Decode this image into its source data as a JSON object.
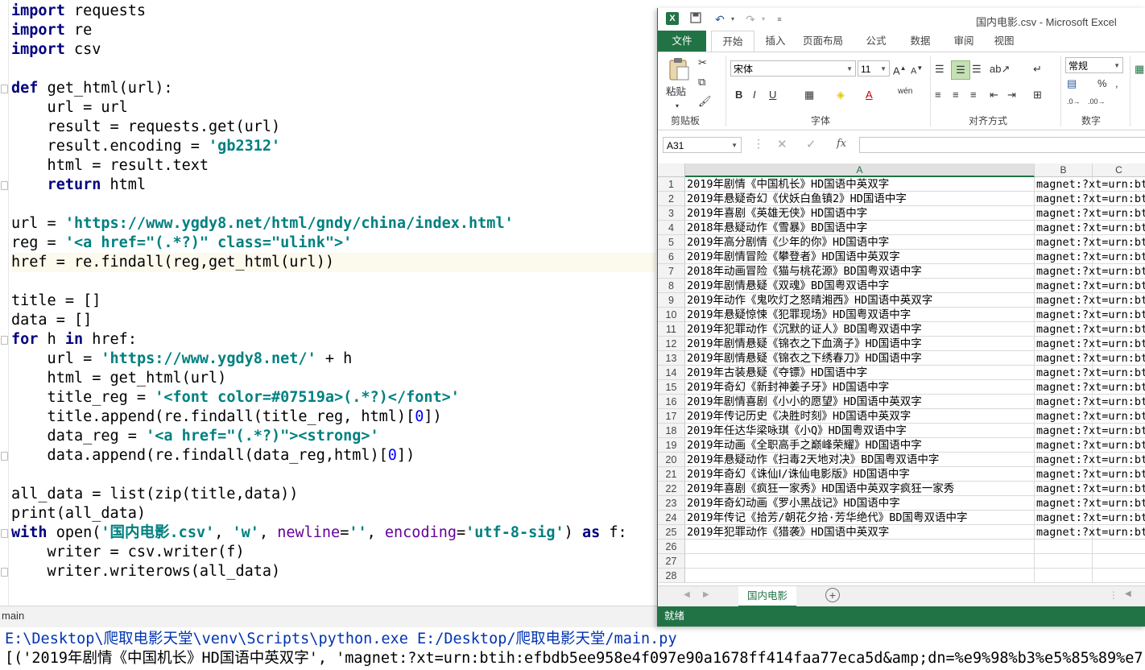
{
  "editor": {
    "lines": [
      [
        [
          "kw",
          "import"
        ],
        [
          "",
          "requests"
        ]
      ],
      [
        [
          "kw",
          "import"
        ],
        [
          "",
          "re"
        ]
      ],
      [
        [
          "kw",
          "import"
        ],
        [
          "",
          "csv"
        ]
      ],
      [],
      [
        [
          "kw",
          "def"
        ],
        [
          "",
          "get_html(url):"
        ]
      ],
      [
        [
          "",
          "    url = url"
        ]
      ],
      [
        [
          "",
          "    result = requests.get(url)"
        ]
      ],
      [
        [
          "",
          "    result.encoding = "
        ],
        [
          "str",
          "'gb2312'"
        ]
      ],
      [
        [
          "",
          "    html = result.text"
        ]
      ],
      [
        [
          "",
          "    "
        ],
        [
          "kw",
          "return"
        ],
        [
          "",
          "html"
        ]
      ],
      [],
      [
        [
          "",
          "url = "
        ],
        [
          "str",
          "'https://www.ygdy8.net/html/gndy/china/index.html'"
        ]
      ],
      [
        [
          "",
          "reg = "
        ],
        [
          "str",
          "'<a href=\"(.*?)\" class=\"ulink\">'"
        ]
      ],
      [
        [
          "",
          "href = re.findall(reg,get_html(url))"
        ]
      ],
      [],
      [
        [
          "",
          "title = []"
        ]
      ],
      [
        [
          "",
          "data = []"
        ]
      ],
      [
        [
          "kw",
          "for"
        ],
        [
          "",
          "h "
        ],
        [
          "kw",
          "in"
        ],
        [
          "",
          "href:"
        ]
      ],
      [
        [
          "",
          "    url = "
        ],
        [
          "str",
          "'https://www.ygdy8.net/'"
        ],
        [
          "",
          " + h"
        ]
      ],
      [
        [
          "",
          "    html = get_html(url)"
        ]
      ],
      [
        [
          "",
          "    title_reg = "
        ],
        [
          "str",
          "'<font color=#07519a>(.*?)</font>'"
        ]
      ],
      [
        [
          "",
          "    title.append(re.findall(title_reg, html)["
        ],
        [
          "num",
          "0"
        ],
        [
          "",
          "])"
        ]
      ],
      [
        [
          "",
          "    data_reg = "
        ],
        [
          "str",
          "'<a href=\"(.*?)\"><strong>'"
        ]
      ],
      [
        [
          "",
          "    data.append(re.findall(data_reg,html)["
        ],
        [
          "num",
          "0"
        ],
        [
          "",
          "])"
        ]
      ],
      [],
      [
        [
          "",
          "all_data = list(zip(title,data))"
        ]
      ],
      [
        [
          "",
          "print(all_data)"
        ]
      ],
      [
        [
          "kw",
          "with"
        ],
        [
          "",
          "open("
        ],
        [
          "str",
          "'国内电影.csv'"
        ],
        [
          "",
          ", "
        ],
        [
          "str",
          "'w'"
        ],
        [
          "",
          ", "
        ],
        [
          "nm",
          "newline"
        ],
        [
          "",
          "="
        ],
        [
          "str",
          "''"
        ],
        [
          "",
          ", "
        ],
        [
          "nm",
          "encoding"
        ],
        [
          "",
          "="
        ],
        [
          "str",
          "'utf-8-sig'"
        ],
        [
          "",
          ") "
        ],
        [
          "kw",
          "as"
        ],
        [
          "",
          "f:"
        ]
      ],
      [
        [
          "",
          "    writer = csv.writer(f)"
        ]
      ],
      [
        [
          "",
          "    writer.writerows(all_data)"
        ]
      ]
    ],
    "highlight_line": 13
  },
  "run": {
    "tab_label": "main",
    "command": "E:\\Desktop\\爬取电影天堂\\venv\\Scripts\\python.exe E:/Desktop/爬取电影天堂/main.py",
    "output": "[('2019年剧情《中国机长》HD国语中英双字', 'magnet:?xt=urn:btih:efbdb5ee958e4f097e90a1678ff414faa77eca5d&amp;dn=%e9%98%b3%e5%85%89%e7"
  },
  "excel": {
    "title": "国内电影.csv - Microsoft Excel",
    "tabs": [
      "文件",
      "开始",
      "插入",
      "页面布局",
      "公式",
      "数据",
      "审阅",
      "视图"
    ],
    "active_tab": "开始",
    "font_name": "宋体",
    "font_size": "11",
    "number_format": "常规",
    "groups": {
      "clipboard": "剪贴板",
      "font": "字体",
      "alignment": "对齐方式",
      "number": "数字"
    },
    "paste_label": "粘贴",
    "namebox": "A31",
    "columns": [
      "A",
      "B",
      "C"
    ],
    "rows": [
      "2019年剧情《中国机长》HD国语中英双字",
      "2019年悬疑奇幻《伏妖白鱼镇2》HD国语中字",
      "2019年喜剧《英雄无侠》HD国语中字",
      "2018年悬疑动作《雪暴》BD国语中字",
      "2019年高分剧情《少年的你》HD国语中字",
      "2019年剧情冒险《攀登者》HD国语中英双字",
      "2018年动画冒险《猫与桃花源》BD国粤双语中字",
      "2019年剧情悬疑《双魂》BD国粤双语中字",
      "2019年动作《鬼吹灯之怒晴湘西》HD国语中英双字",
      "2019年悬疑惊悚《犯罪现场》HD国粤双语中字",
      "2019年犯罪动作《沉默的证人》BD国粤双语中字",
      "2019年剧情悬疑《锦衣之下血滴子》HD国语中字",
      "2019年剧情悬疑《锦衣之下绣春刀》HD国语中字",
      "2019年古装悬疑《夺镖》HD国语中字",
      "2019年奇幻《新封神姜子牙》HD国语中字",
      "2019年剧情喜剧《小小的愿望》HD国语中英双字",
      "2019年传记历史《决胜时刻》HD国语中英双字",
      "2019年任达华梁咏琪《小Q》HD国粤双语中字",
      "2019年动画《全职高手之巅峰荣耀》HD国语中字",
      "2019年悬疑动作《扫毒2天地对决》BD国粤双语中字",
      "2019年奇幻《诛仙Ⅰ/诛仙电影版》HD国语中字",
      "2019年喜剧《疯狂一家秀》HD国语中英双字疯狂一家秀",
      "2019年奇幻动画《罗小黑战记》HD国语中字",
      "2019年传记《拾芳/朝花夕拾·芳华绝代》BD国粤双语中字",
      "2019年犯罪动作《猎袭》HD国语中英双字"
    ],
    "magnet": "magnet:?xt=urn:btih",
    "empty_rows": [
      26,
      27,
      28
    ],
    "sheet_tab": "国内电影",
    "status": "就绪",
    "accent": "#217346"
  }
}
